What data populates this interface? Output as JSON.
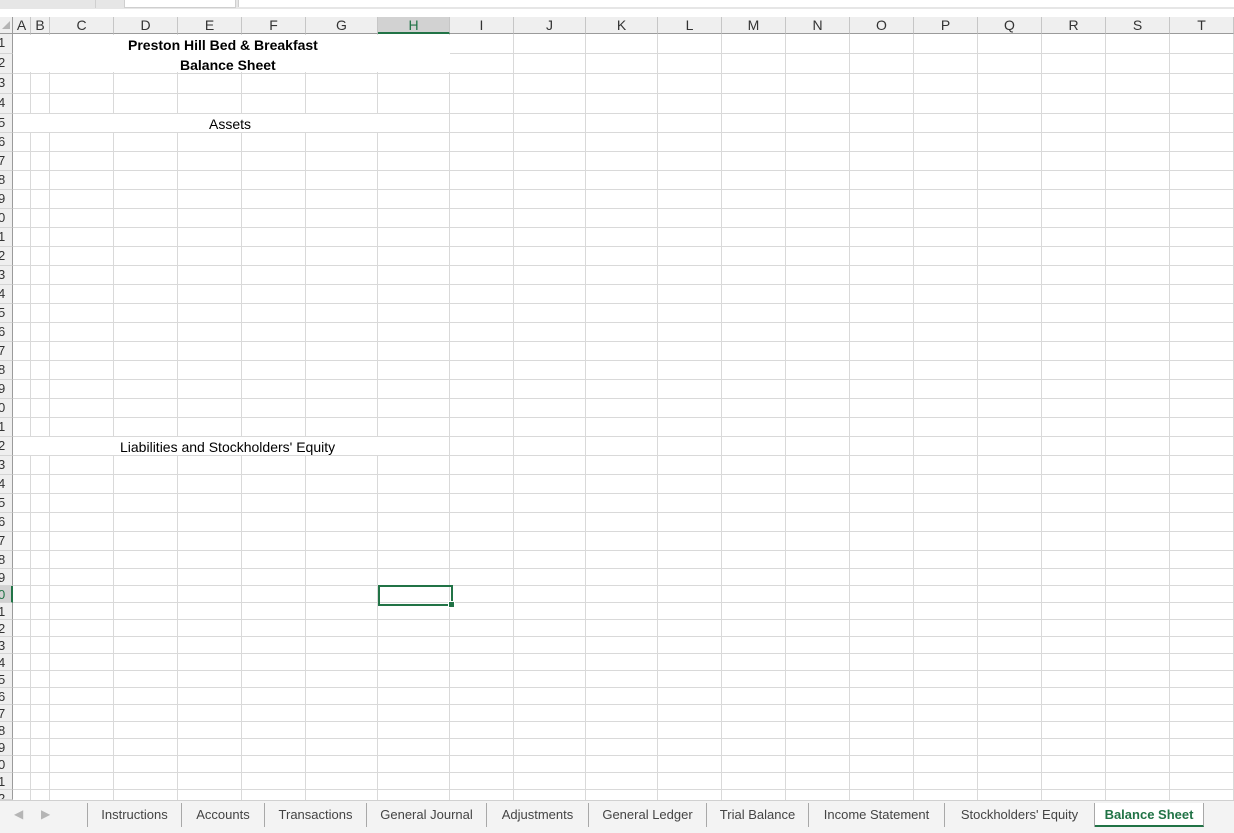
{
  "columns": [
    "A",
    "B",
    "C",
    "D",
    "E",
    "F",
    "G",
    "H",
    "I",
    "J",
    "K",
    "L",
    "M",
    "N",
    "O",
    "P",
    "Q",
    "R",
    "S",
    "T"
  ],
  "selected_column": "H",
  "row_labels": [
    "1",
    "2",
    "3",
    "4",
    "5",
    "6",
    "7",
    "8",
    "9",
    "0",
    "1",
    "2",
    "3",
    "4",
    "5",
    "6",
    "7",
    "8",
    "9",
    "0",
    "1",
    "2",
    "3",
    "4",
    "5",
    "6",
    "7",
    "8",
    "9",
    "0",
    "1",
    "2",
    "3",
    "4",
    "5",
    "6",
    "7",
    "8",
    "9",
    "0",
    "1",
    "2"
  ],
  "cells": {
    "title": "Preston Hill  Bed & Breakfast",
    "subtitle": "Balance Sheet",
    "assets_heading": "Assets",
    "liabilities_heading": "Liabilities and Stockholders' Equity"
  },
  "sheet_tabs": [
    "Instructions",
    "Accounts",
    "Transactions",
    "General Journal",
    "Adjustments",
    "General Ledger",
    "Trial Balance",
    "Income Statement",
    "Stockholders' Equity",
    "Balance Sheet"
  ],
  "active_tab": "Balance Sheet",
  "icons": {
    "nav_prev": "chevron-left-icon",
    "nav_next": "chevron-right-icon"
  },
  "colors": {
    "accent": "#217346",
    "gridline": "#d9d9d9",
    "header_bg": "#efefef"
  }
}
